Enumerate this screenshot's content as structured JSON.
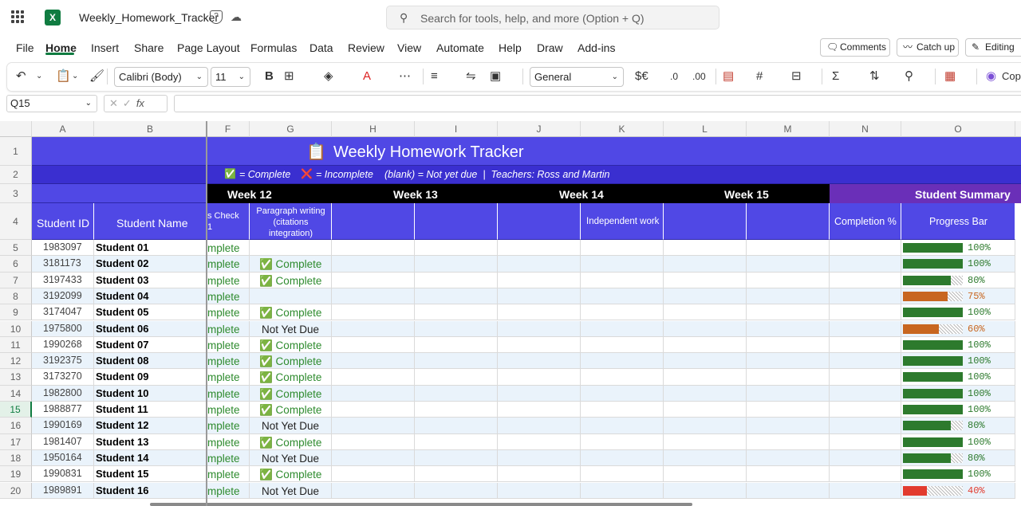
{
  "app": {
    "filename": "Weekly_Homework_Tracker",
    "search_placeholder": "Search for tools, help, and more (Option + Q)",
    "excel_badge": "X"
  },
  "menu": [
    "File",
    "Home",
    "Insert",
    "Share",
    "Page Layout",
    "Formulas",
    "Data",
    "Review",
    "View",
    "Automate",
    "Help",
    "Draw",
    "Add-ins"
  ],
  "top_buttons": {
    "comments": "Comments",
    "catchup": "Catch up",
    "editing": "Editing"
  },
  "ribbon": {
    "font": "Calibri (Body)",
    "size": "11",
    "number_format": "General",
    "currency": "$€",
    "copilot": "Cop"
  },
  "formula_bar": {
    "name_box": "Q15",
    "fx": "fx"
  },
  "columns": [
    "A",
    "B",
    "F",
    "G",
    "H",
    "I",
    "J",
    "K",
    "L",
    "M",
    "N",
    "O"
  ],
  "sheet": {
    "title": "Weekly Homework Tracker",
    "title_emoji": "📋",
    "legend": {
      "complete_icon": "✅",
      "complete": "= Complete",
      "incomplete_icon": "❌",
      "incomplete": "= Incomplete",
      "blank": "(blank) = Not yet due  |  Teachers: Ross and Martin"
    },
    "weeks": [
      "Week 12",
      "Week 13",
      "Week 14",
      "Week 15"
    ],
    "summary_header": "Student Summary",
    "headers": {
      "id": "Student ID",
      "name": "Student Name",
      "f": "s Check\n1",
      "g": "Paragraph writing (citations integration)",
      "k": "Independent work",
      "n": "Completion %",
      "o": "Progress Bar"
    },
    "rows": [
      {
        "row": "5",
        "id": "1983097",
        "name": "Student 01",
        "f": "mplete",
        "g": "",
        "pct": 100
      },
      {
        "row": "6",
        "id": "3181173",
        "name": "Student 02",
        "f": "mplete",
        "g": "✅  Complete",
        "pct": 100
      },
      {
        "row": "7",
        "id": "3197433",
        "name": "Student 03",
        "f": "mplete",
        "g": "✅  Complete",
        "pct": 80
      },
      {
        "row": "8",
        "id": "3192099",
        "name": "Student 04",
        "f": "mplete",
        "g": "",
        "pct": 75
      },
      {
        "row": "9",
        "id": "3174047",
        "name": "Student 05",
        "f": "mplete",
        "g": "✅  Complete",
        "pct": 100
      },
      {
        "row": "10",
        "id": "1975800",
        "name": "Student 06",
        "f": "mplete",
        "g": "Not Yet Due",
        "pct": 60
      },
      {
        "row": "11",
        "id": "1990268",
        "name": "Student 07",
        "f": "mplete",
        "g": "✅  Complete",
        "pct": 100
      },
      {
        "row": "12",
        "id": "3192375",
        "name": "Student 08",
        "f": "mplete",
        "g": "✅  Complete",
        "pct": 100
      },
      {
        "row": "13",
        "id": "3173270",
        "name": "Student 09",
        "f": "mplete",
        "g": "✅  Complete",
        "pct": 100
      },
      {
        "row": "14",
        "id": "1982800",
        "name": "Student 10",
        "f": "mplete",
        "g": "✅  Complete",
        "pct": 100
      },
      {
        "row": "15",
        "id": "1988877",
        "name": "Student 11",
        "f": "mplete",
        "g": "✅  Complete",
        "pct": 100
      },
      {
        "row": "16",
        "id": "1990169",
        "name": "Student 12",
        "f": "mplete",
        "g": "Not Yet Due",
        "pct": 80
      },
      {
        "row": "17",
        "id": "1981407",
        "name": "Student 13",
        "f": "mplete",
        "g": "✅  Complete",
        "pct": 100
      },
      {
        "row": "18",
        "id": "1950164",
        "name": "Student 14",
        "f": "mplete",
        "g": "Not Yet Due",
        "pct": 80
      },
      {
        "row": "19",
        "id": "1990831",
        "name": "Student 15",
        "f": "mplete",
        "g": "✅  Complete",
        "pct": 100
      },
      {
        "row": "20",
        "id": "1989891",
        "name": "Student 16",
        "f": "mplete",
        "g": "Not Yet Due",
        "pct": 40
      }
    ],
    "pct_labels": [
      "100%",
      "100%",
      "80%",
      "75%",
      "100%",
      "60%",
      "100%",
      "100%",
      "100%",
      "100%",
      "100%",
      "80%",
      "100%",
      "80%",
      "100%",
      "40%"
    ],
    "colors": {
      "header_blue": "#5048e5",
      "legend_blue": "#3a2fd0",
      "week_black": "#000000",
      "summary_purple": "#6a2fb8",
      "green": "#2d7a2d",
      "orange": "#c8661f",
      "red": "#e23b2e",
      "alt_row": "#eaf3fb",
      "complete_text": "#2e8b2e"
    }
  }
}
